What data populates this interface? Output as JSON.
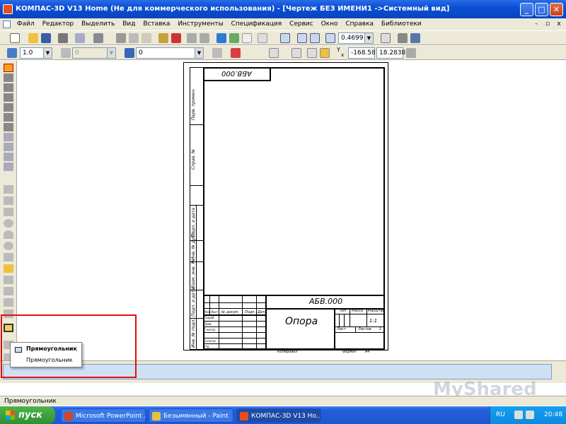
{
  "window": {
    "title": "КОМПАС-3D V13 Home (Не для коммерческого использования) - [Чертеж БЕЗ ИМЕНИ1 ->Системный вид]",
    "min_label": "_",
    "max_label": "□",
    "close_label": "✕"
  },
  "menu": {
    "items": [
      "Файл",
      "Редактор",
      "Выделить",
      "Вид",
      "Вставка",
      "Инструменты",
      "Спецификация",
      "Сервис",
      "Окно",
      "Справка",
      "Библиотеки"
    ],
    "mdi_min": "-",
    "mdi_restore": "▫",
    "mdi_close": "x"
  },
  "toolbar1": {
    "zoom_value": "0.4699"
  },
  "toolbar2": {
    "step_value": "1.0",
    "disabled_value": "0",
    "layer_value": "0",
    "x_label": "Y",
    "x_sub": "x",
    "coord_x": "-168.58",
    "coord_y": "18.2838"
  },
  "drawing": {
    "top_code": "АБВ.000",
    "designation": "АБВ.000",
    "name": "Опора",
    "lit": "Лит",
    "mass": "Масса",
    "scale": "Масштаб",
    "scale_value": "1:1",
    "sheet": "Лист",
    "sheets": "Листов",
    "sheets_value": "1",
    "izm": "Изм.",
    "list": "Лист",
    "doc_no": "№ докум.",
    "sign": "Подп.",
    "date": "Дата",
    "razrab": "Разраб.",
    "prov": "Пров.",
    "tkontr": "Т.контр.",
    "nkontr": "Н.контр.",
    "utv": "Утв.",
    "copied": "Копировал",
    "format": "Формат",
    "format_value": "А4",
    "side_labels": [
      "Перв. примен.",
      "Справ. №",
      "Подп. и дата",
      "Инв. № дубл.",
      "Взам. инв. №",
      "Подп. и дата",
      "Инв. № подл."
    ]
  },
  "tooltip": {
    "title": "Прямоугольник",
    "subtitle": "Прямоугольник"
  },
  "status": {
    "text": "Прямоугольник"
  },
  "taskbar": {
    "start": "пуск",
    "tasks": [
      "Microsoft PowerPoint ...",
      "Безымянный - Paint",
      "КОМПАС-3D V13 Ho..."
    ],
    "lang": "RU",
    "clock": "20:48"
  },
  "watermark": "MyShared",
  "colors": {
    "titlebar": "#0a4fd4",
    "highlight": "#e01010",
    "taskbar": "#245edb"
  }
}
